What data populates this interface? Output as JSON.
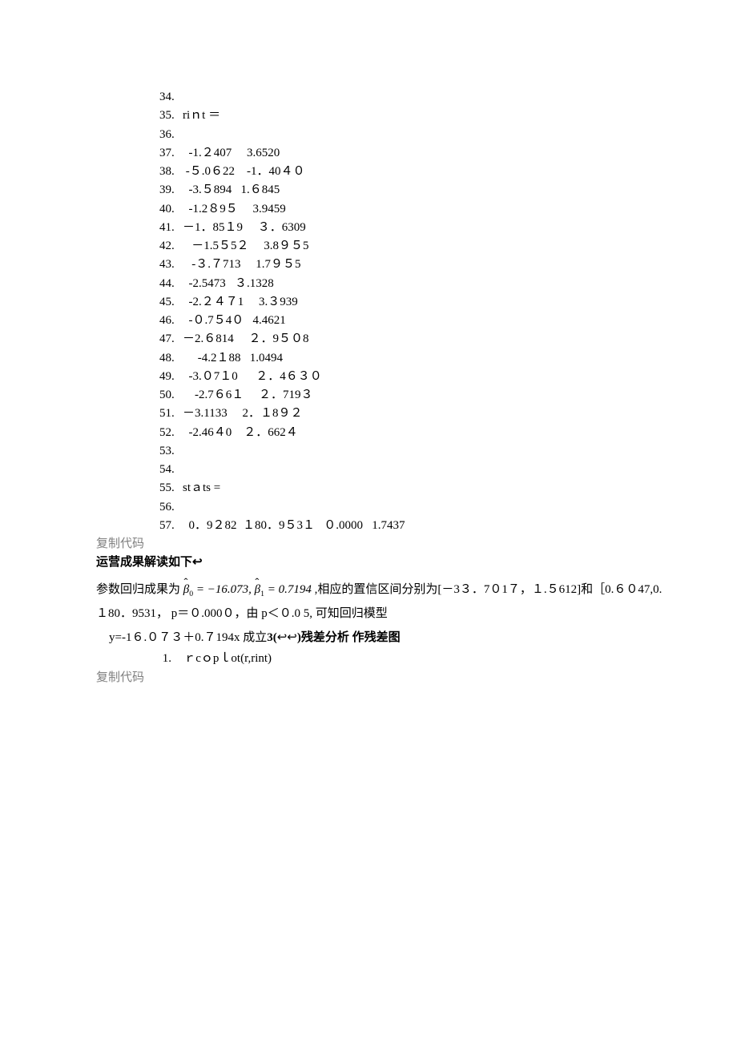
{
  "lines": {
    "l34": "",
    "l35": "riｎt ＝",
    "l36": "",
    "l37": "  -1.２407     3.6520",
    "l38": " -５.0６22    -1．40４０",
    "l39": "  -3.５894   1.６845",
    "l40": "  -1.2８9５     3.9459",
    "l41": "－1．85１9     ３．6309",
    "l42": "   －1.5５5２     3.8９５5",
    "l43": "   -３.７713     1.7９５5",
    "l44": "  -2.5473   ３.1328",
    "l45": "  -2.２４７1     3.３939",
    "l46": "  -０.7５4０   4.4621",
    "l47": "－2.６814     ２．9５０8",
    "l48": "     -4.2１88   1.0494",
    "l49": "  -3.０7１0      ２．4６３０",
    "l50": "    -2.7６6１     ２．719３",
    "l51": "－3.1133     2．１8９２",
    "l52": "  -2.46４0    ２．662４",
    "l53": "",
    "l54": "",
    "l55": "stａts =",
    "l56": "",
    "l57": "  0．9２82  １80．9５3１   ０.0000   1.7437"
  },
  "copy_label": "复制代码",
  "heading": "运营成果解读如下",
  "heading_symbol": "↩",
  "para1_prefix": "参数回归成果为 ",
  "formula_text": "β̂₀ = −16.073, β̂₁ = 0.7194",
  "para1_suffix": " ,相应的置信区间分别为[－3３．7０1７，１.５612]和［0.６０47,0.",
  "para2": "１80．9531， p＝０.000０，由 p＜０.0 5, 可知回归模型",
  "para3_prefix": "  y=-1６.０７３＋0.７194x 成立",
  "para3_bold": "3(",
  "para3_sym": "↩↩",
  "para3_bold2": ")残差分析  作残差图",
  "residual_line_num": "1.",
  "residual_line": "   ｒcｏpｌot(r,rint)"
}
